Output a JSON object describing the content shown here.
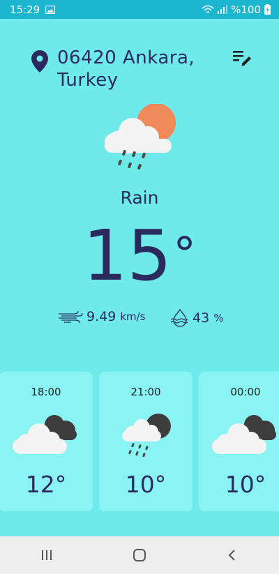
{
  "status_bar": {
    "time": "15:29",
    "battery": "%100",
    "icons": [
      "image-icon",
      "wifi-icon",
      "signal-icon",
      "battery-charging-icon"
    ]
  },
  "location": {
    "line1": "06420 Ankara,",
    "line2": "Turkey",
    "icon": "location-pin-icon"
  },
  "current": {
    "condition": "Rain",
    "temperature": "15",
    "degree_symbol": "°",
    "icon": "rain-cloud-sun-icon",
    "wind": {
      "value": "9.49",
      "unit": "km/s",
      "icon": "wind-icon"
    },
    "humidity": {
      "value": "43",
      "unit": "%",
      "icon": "humidity-drop-icon"
    }
  },
  "forecast": [
    {
      "time": "18:00",
      "temp": "12°",
      "icon": "cloudy-icon"
    },
    {
      "time": "21:00",
      "temp": "10°",
      "icon": "rain-cloud-moon-icon"
    },
    {
      "time": "00:00",
      "temp": "10°",
      "icon": "cloudy-icon"
    }
  ],
  "colors": {
    "background": "#6eeaea",
    "status_bar": "#1cb7cf",
    "card": "#8af4f4",
    "text_primary": "#2b2a5e",
    "sun": "#f08a5a"
  },
  "nav_bar": {
    "buttons": [
      "recent-apps-icon",
      "home-icon",
      "back-icon"
    ]
  }
}
